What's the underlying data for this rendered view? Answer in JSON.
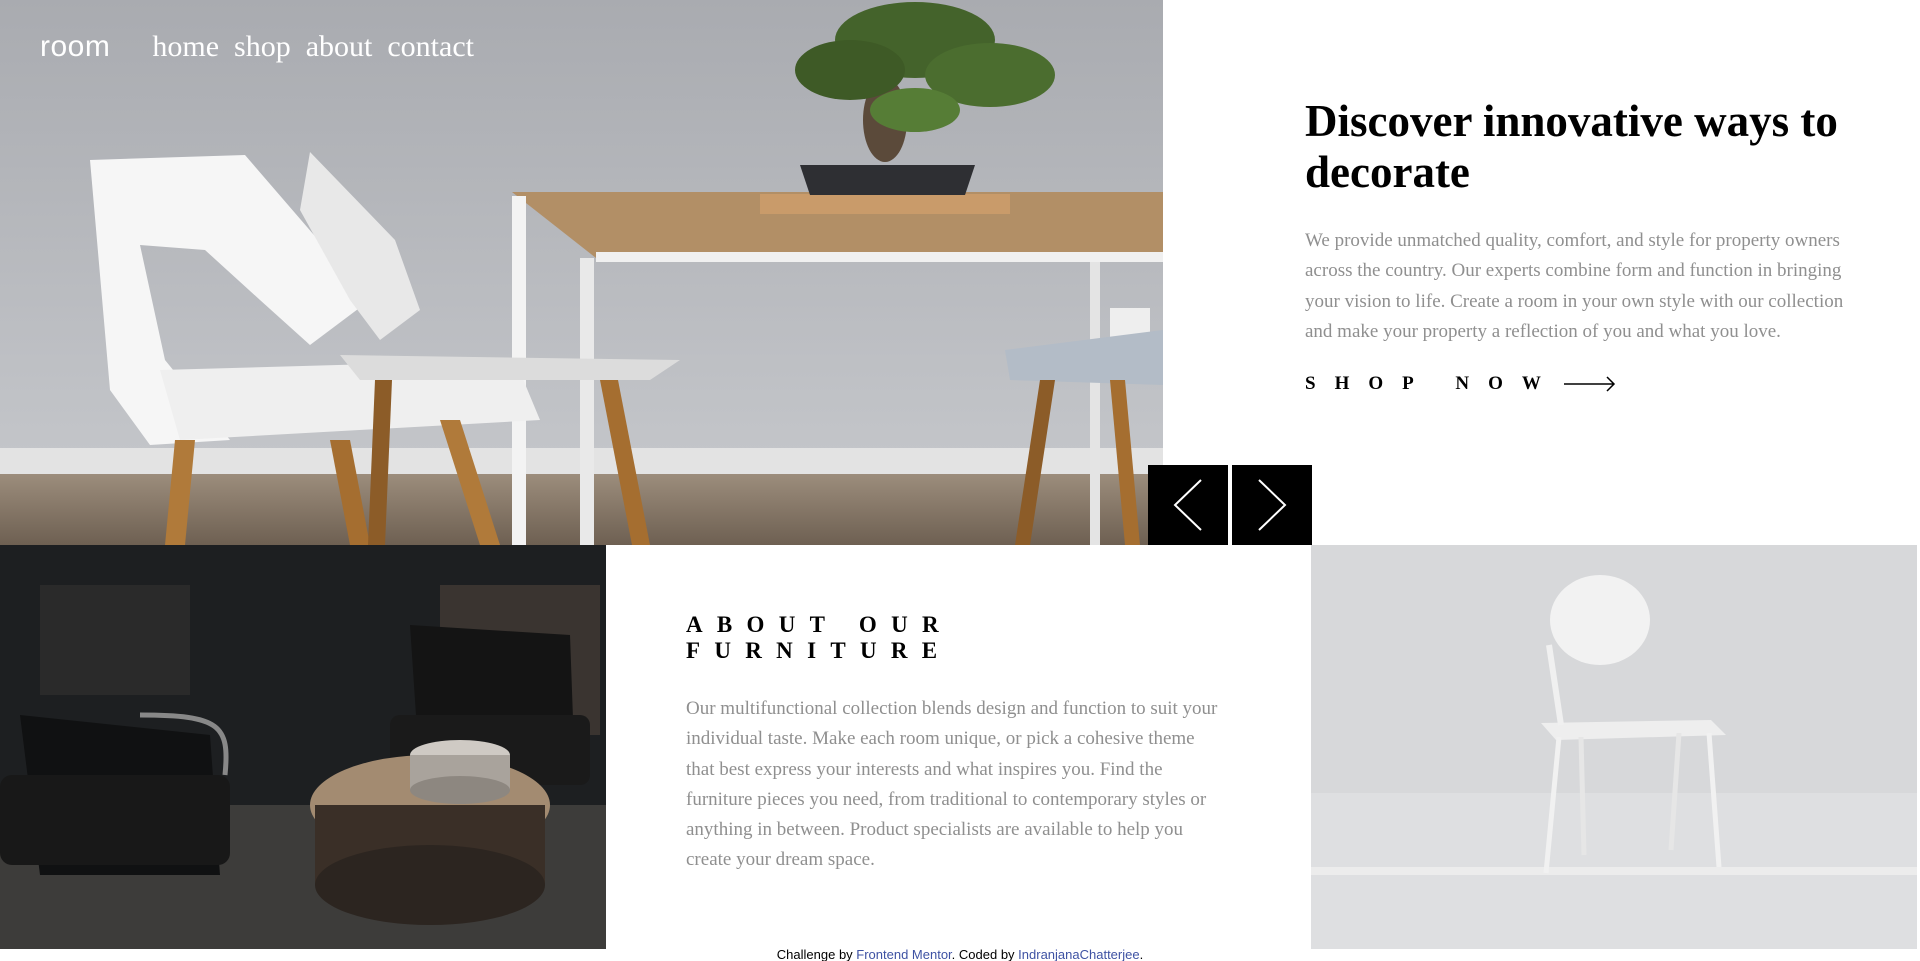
{
  "nav": {
    "logo": "room",
    "links": [
      "home",
      "shop",
      "about",
      "contact"
    ]
  },
  "hero": {
    "title": "Discover innovative ways to decorate",
    "description": "We provide unmatched quality, comfort, and style for property owners across the country. Our experts combine form and function in bringing your vision to life. Create a room in your own style with our collection and make your property a reflection of you and what you love.",
    "cta_label": "SHOP NOW",
    "cta_icon": "arrow-right-icon"
  },
  "slider": {
    "prev_icon": "chevron-left-icon",
    "next_icon": "chevron-right-icon"
  },
  "about": {
    "title": "ABOUT OUR FURNITURE",
    "description": "Our multifunctional collection blends design and function to suit your individual taste. Make each room unique, or pick a cohesive theme that best express your interests and what inspires you. Find the furniture pieces you need, from traditional to contemporary styles or anything in between. Product specialists are available to help you create your dream space."
  },
  "footer": {
    "prefix": "Challenge by ",
    "link1": "Frontend Mentor",
    "middle": ". Coded by ",
    "link2": "IndranjanaChatterjee",
    "suffix": "."
  },
  "colors": {
    "accent": "#000000",
    "muted_text": "#8f8f8f",
    "link": "#3e52a3"
  }
}
